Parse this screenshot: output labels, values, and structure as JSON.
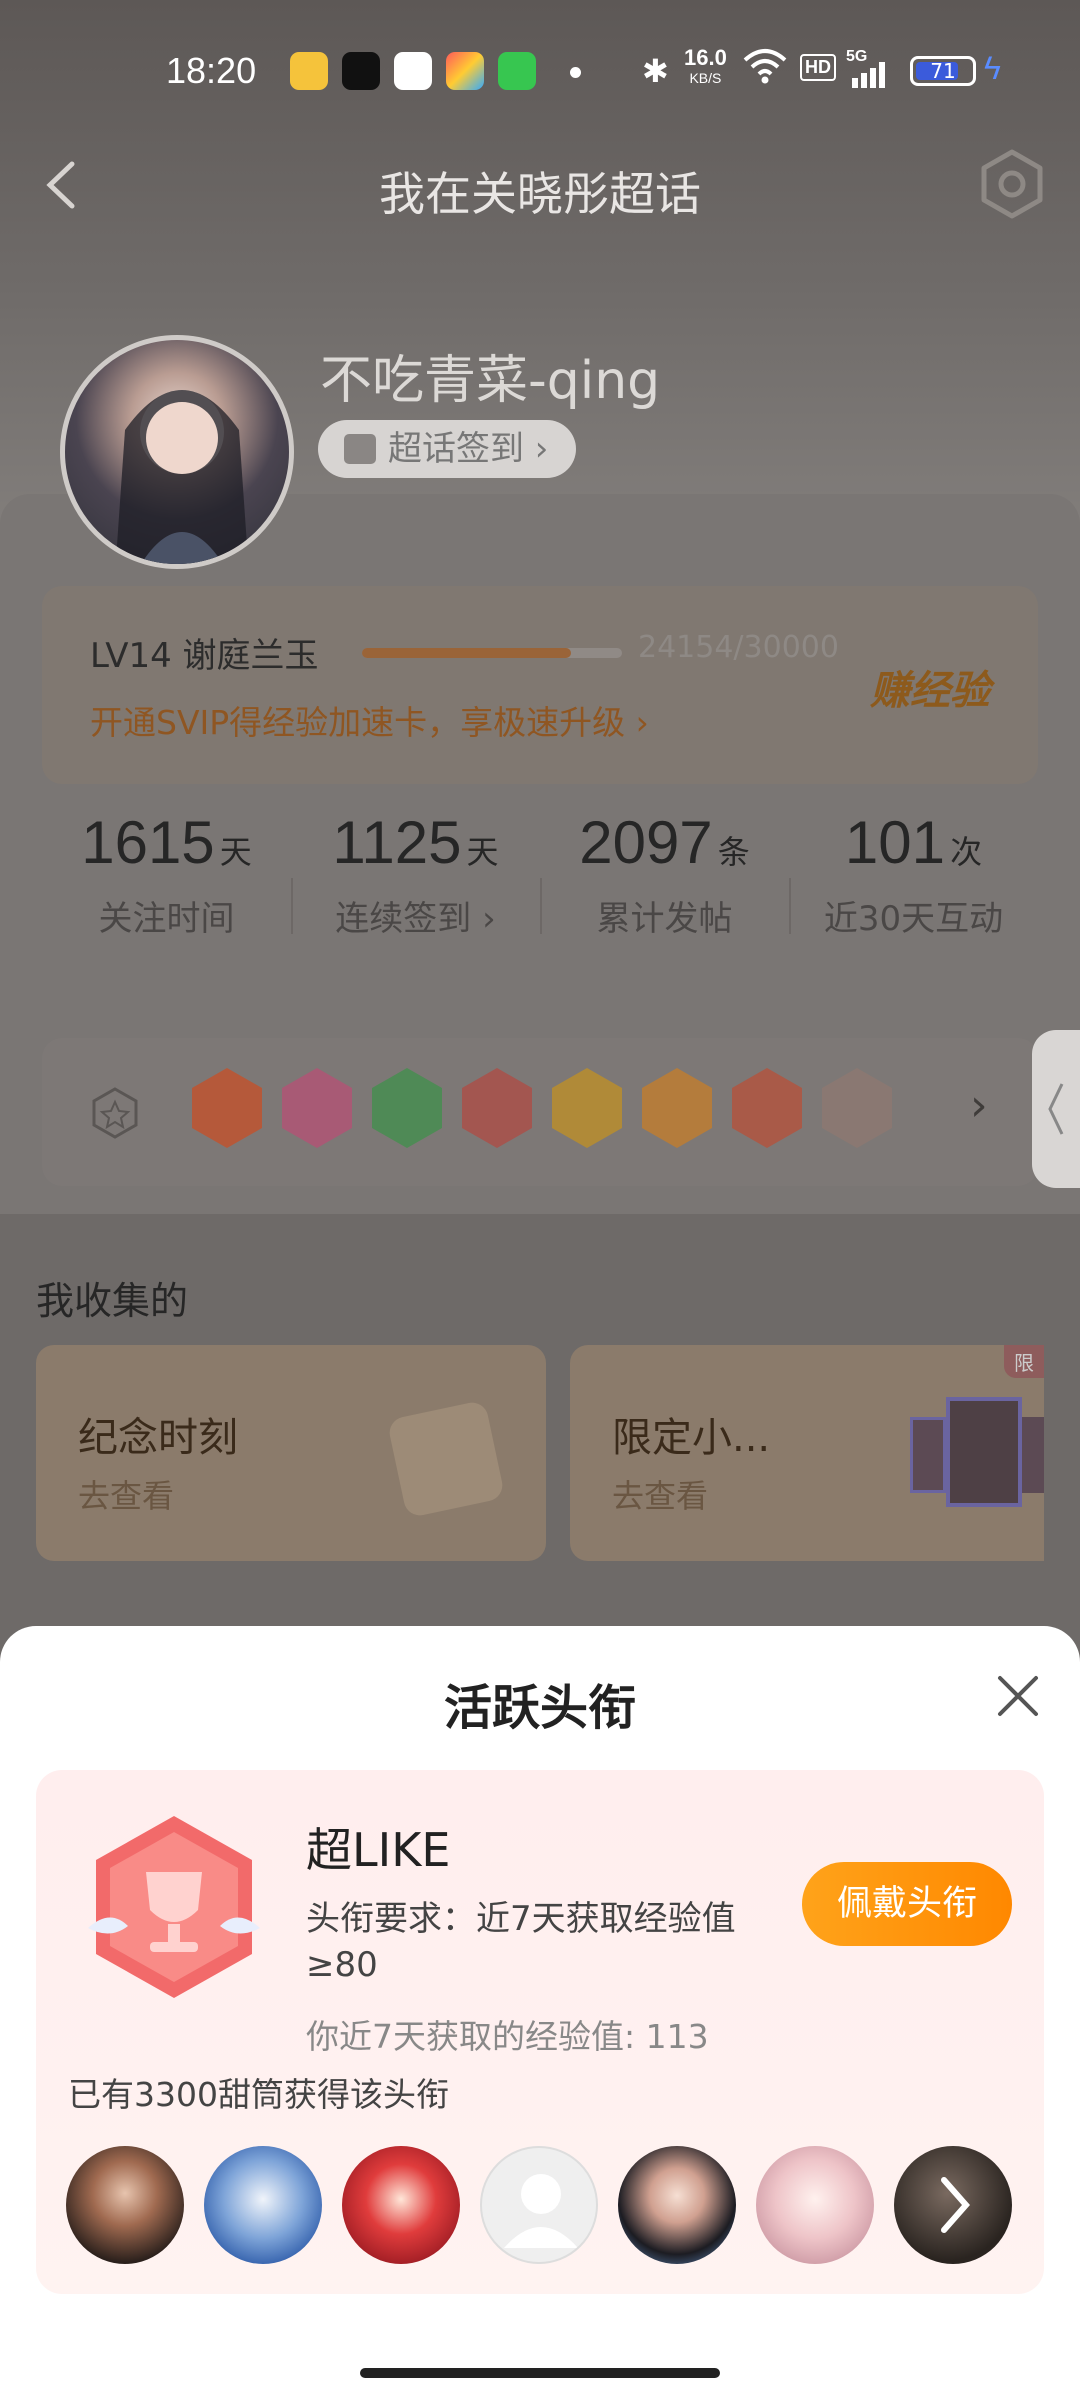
{
  "status_bar": {
    "time": "18:20",
    "app_icons": [
      "weibo-icon",
      "tiktok-icon",
      "search-app-icon",
      "photos-icon",
      "messages-icon"
    ],
    "network_speed_value": "16.0",
    "network_speed_unit": "KB/S",
    "hd": "HD",
    "signal": "5G",
    "battery": "71"
  },
  "nav": {
    "title": "我在关晓彤超话"
  },
  "profile": {
    "username": "不吃青菜-qing",
    "signin_label": "超话签到 ›"
  },
  "level": {
    "name": "LV14 谢庭兰玉",
    "progress_text": "24154/30000",
    "progress_fraction": 0.805,
    "svip_promo": "开通SVIP得经验加速卡，享极速升级 ›",
    "earn_label": "赚经验"
  },
  "stats": [
    {
      "value": "1615",
      "unit": "天",
      "label": "关注时间"
    },
    {
      "value": "1125",
      "unit": "天",
      "label": "连续签到 ›"
    },
    {
      "value": "2097",
      "unit": "条",
      "label": "累计发帖"
    },
    {
      "value": "101",
      "unit": "次",
      "label": "近30天互动"
    }
  ],
  "badges": {
    "arrow": "›"
  },
  "collection": {
    "title": "我收集的",
    "cards": [
      {
        "title": "纪念时刻",
        "sub": "去查看"
      },
      {
        "title": "限定小...",
        "sub": "去查看",
        "tag": "限"
      }
    ]
  },
  "sheet": {
    "title": "活跃头衔",
    "title_name": "超LIKE",
    "requirement": "头衔要求：近7天获取经验值≥80",
    "obtained": "你近7天获取的经验值: 113",
    "wear_button": "佩戴头衔",
    "owners_text": "已有3300甜筒获得该头衔"
  },
  "colors": {
    "accent_orange": "#ff8f0f",
    "sheet_bg": "#ffffff",
    "card_pink": "#ffeeee"
  }
}
